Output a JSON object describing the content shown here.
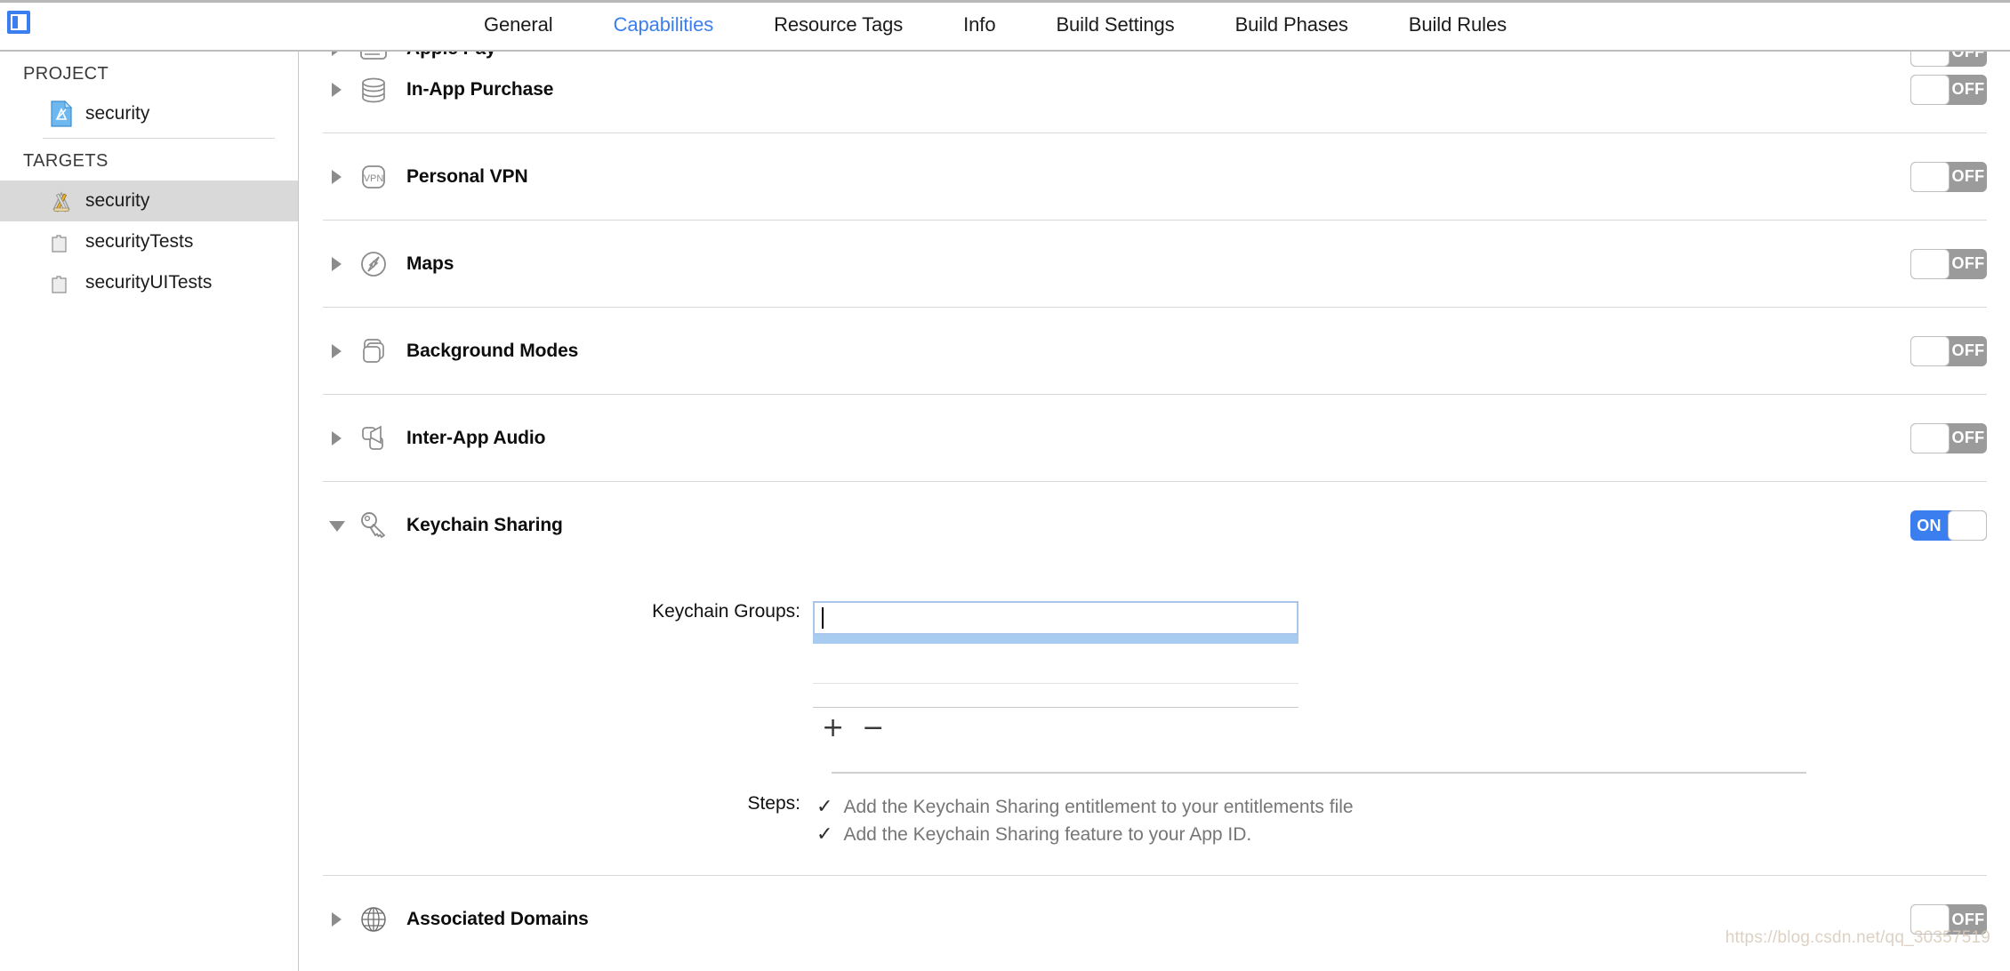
{
  "window": {
    "panel_toggle_icon": "navigator-panel-icon"
  },
  "tabs": [
    {
      "label": "General",
      "active": false
    },
    {
      "label": "Capabilities",
      "active": true
    },
    {
      "label": "Resource Tags",
      "active": false
    },
    {
      "label": "Info",
      "active": false
    },
    {
      "label": "Build Settings",
      "active": false
    },
    {
      "label": "Build Phases",
      "active": false
    },
    {
      "label": "Build Rules",
      "active": false
    }
  ],
  "sidebar": {
    "project_header": "PROJECT",
    "targets_header": "TARGETS",
    "project_items": [
      {
        "label": "security",
        "icon": "xcode-project-icon",
        "selected": false
      }
    ],
    "target_items": [
      {
        "label": "security",
        "icon": "app-target-icon",
        "selected": true
      },
      {
        "label": "securityTests",
        "icon": "test-bundle-icon",
        "selected": false
      },
      {
        "label": "securityUITests",
        "icon": "test-bundle-icon",
        "selected": false
      }
    ]
  },
  "capabilities": [
    {
      "name": "Apple Pay",
      "icon": "apple-pay-icon",
      "state": "OFF",
      "expanded": false,
      "clipped": true
    },
    {
      "name": "In-App Purchase",
      "icon": "in-app-purchase-icon",
      "state": "OFF",
      "expanded": false
    },
    {
      "name": "Personal VPN",
      "icon": "vpn-icon",
      "state": "OFF",
      "expanded": false
    },
    {
      "name": "Maps",
      "icon": "maps-compass-icon",
      "state": "OFF",
      "expanded": false
    },
    {
      "name": "Background Modes",
      "icon": "background-modes-icon",
      "state": "OFF",
      "expanded": false
    },
    {
      "name": "Inter-App Audio",
      "icon": "inter-app-audio-icon",
      "state": "OFF",
      "expanded": false
    },
    {
      "name": "Keychain Sharing",
      "icon": "key-icon",
      "state": "ON",
      "expanded": true
    },
    {
      "name": "Associated Domains",
      "icon": "globe-icon",
      "state": "OFF",
      "expanded": false,
      "clipped": true
    }
  ],
  "keychain_sharing": {
    "groups_label": "Keychain Groups:",
    "groups_value": "",
    "groups_placeholder": "",
    "add_button": "+",
    "remove_button": "−",
    "steps_label": "Steps:",
    "steps": [
      {
        "check": "✓",
        "text": "Add the Keychain Sharing entitlement to your entitlements file"
      },
      {
        "check": "✓",
        "text": "Add the Keychain Sharing feature to your App ID."
      }
    ]
  },
  "switch_labels": {
    "on": "ON",
    "off": "OFF"
  },
  "colors": {
    "accent_blue": "#3b7ef0",
    "switch_off_gray": "#9b9b9b",
    "selection_gray": "#d9d9d9",
    "selection_band_blue": "#a8cbf0",
    "field_border_blue": "#a9c6ea",
    "step_text_gray": "#767676"
  },
  "watermark": {
    "text": "https://blog.csdn.net/qq_30357519"
  }
}
